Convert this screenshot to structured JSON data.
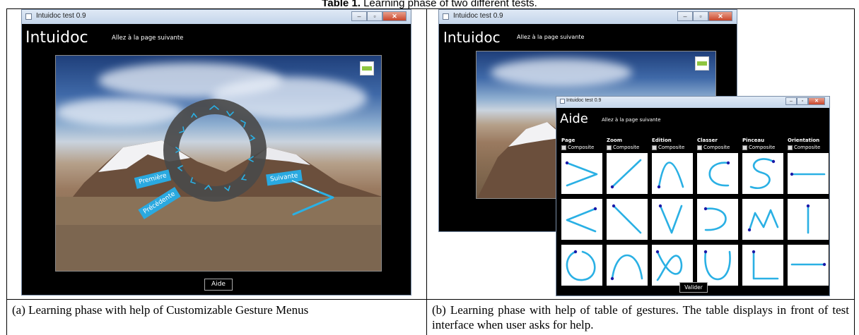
{
  "table_caption": {
    "label": "Table 1.",
    "text": " Learning phase of two different tests."
  },
  "panel_a": {
    "window_title": "Intuidoc test 0.9",
    "app_title": "Intuidoc",
    "app_subtitle": "Allez à la page suivante",
    "menu_labels": {
      "first": "Première",
      "previous": "Précédente",
      "next": "Suivante"
    },
    "help_button": "Aide",
    "caption": "(a) Learning phase with help of Customizable Gesture Menus"
  },
  "panel_b": {
    "window_title": "Intuidoc test 0.9",
    "app_title": "Intuidoc",
    "app_subtitle": "Allez à la page suivante",
    "help_window": {
      "window_title": "Intuidoc test 0.9",
      "title": "Aide",
      "subtitle": "Allez à la page suivante",
      "columns": [
        {
          "name": "Page",
          "option": "Composite"
        },
        {
          "name": "Zoom",
          "option": "Composite"
        },
        {
          "name": "Edition",
          "option": "Composite"
        },
        {
          "name": "Classer",
          "option": "Composite"
        },
        {
          "name": "Pinceau",
          "option": "Composite"
        },
        {
          "name": "Orientation",
          "option": "Composite"
        }
      ],
      "validate_button": "Valider"
    },
    "caption": "(b) Learning phase with help of table of gestures. The table displays in front of test interface when user asks for help."
  },
  "colors": {
    "gesture_stroke": "#2ab0e4",
    "gesture_dot": "#1a1aa8",
    "menu_label": "#2aa9e0",
    "green_indicator": "#8ec63f"
  }
}
